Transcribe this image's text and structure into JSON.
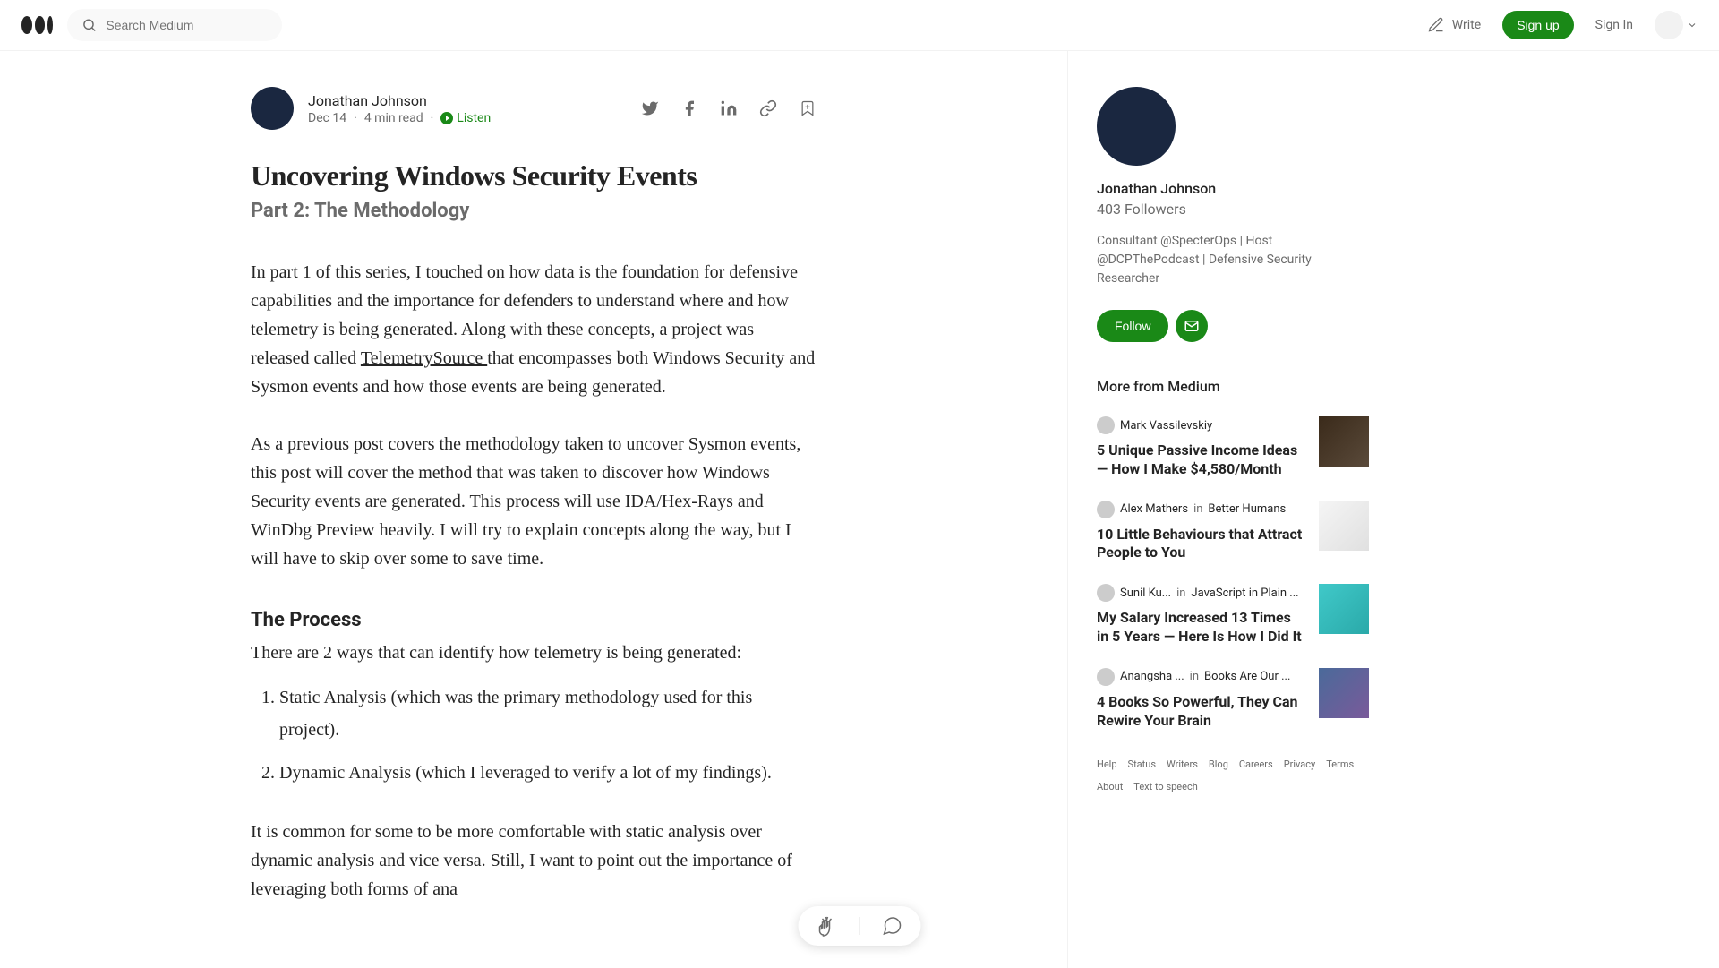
{
  "header": {
    "search_placeholder": "Search Medium",
    "write_label": "Write",
    "signup_label": "Sign up",
    "signin_label": "Sign In"
  },
  "article": {
    "author_name": "Jonathan Johnson",
    "date": "Dec 14",
    "read_time": "4 min read",
    "listen_label": "Listen",
    "title": "Uncovering Windows Security Events",
    "subtitle": "Part 2: The Methodology",
    "para1_before": "In part 1 of this series, I touched on how data is the foundation for defensive capabilities and the importance for defenders to understand where and how telemetry is being generated. Along with these concepts, a project was released called ",
    "para1_link": "TelemetrySource ",
    "para1_after": "that encompasses both Windows Security and Sysmon events and how those events are being generated.",
    "para2": "As a previous post covers the methodology taken to uncover Sysmon events, this post will cover the method that was taken to discover how Windows Security events are generated. This process will use IDA/Hex-Rays and WinDbg Preview heavily. I will try to explain concepts along the way, but I will have to skip over some to save time.",
    "section_heading": "The Process",
    "para3": "There are 2 ways that can identify how telemetry is being generated:",
    "list_item1": "Static Analysis (which was the primary methodology used for this project).",
    "list_item2": "Dynamic Analysis (which I leveraged to verify a lot of my findings).",
    "para4": "It is common for some to be more comfortable with static analysis over dynamic analysis and vice versa. Still, I want to point out the importance of leveraging both forms of ana"
  },
  "sidebar": {
    "name": "Jonathan Johnson",
    "followers": "403 Followers",
    "bio": "Consultant @SpecterOps | Host @DCPThePodcast | Defensive Security Researcher",
    "follow_label": "Follow",
    "more_heading": "More from Medium",
    "items": [
      {
        "author": "Mark Vassilevskiy",
        "title": "5 Unique Passive Income Ideas — How I Make $4,580/Month"
      },
      {
        "author": "Alex Mathers",
        "pub": "Better Humans",
        "title": "10 Little Behaviours that Attract People to You"
      },
      {
        "author": "Sunil Ku...",
        "pub": "JavaScript in Plain ...",
        "title": "My Salary Increased 13 Times in 5 Years — Here Is How I Did It"
      },
      {
        "author": "Anangsha ...",
        "pub": "Books Are Our ...",
        "title": "4 Books So Powerful, They Can Rewire Your Brain"
      }
    ]
  },
  "footer": {
    "links": [
      "Help",
      "Status",
      "Writers",
      "Blog",
      "Careers",
      "Privacy",
      "Terms",
      "About",
      "Text to speech"
    ]
  }
}
